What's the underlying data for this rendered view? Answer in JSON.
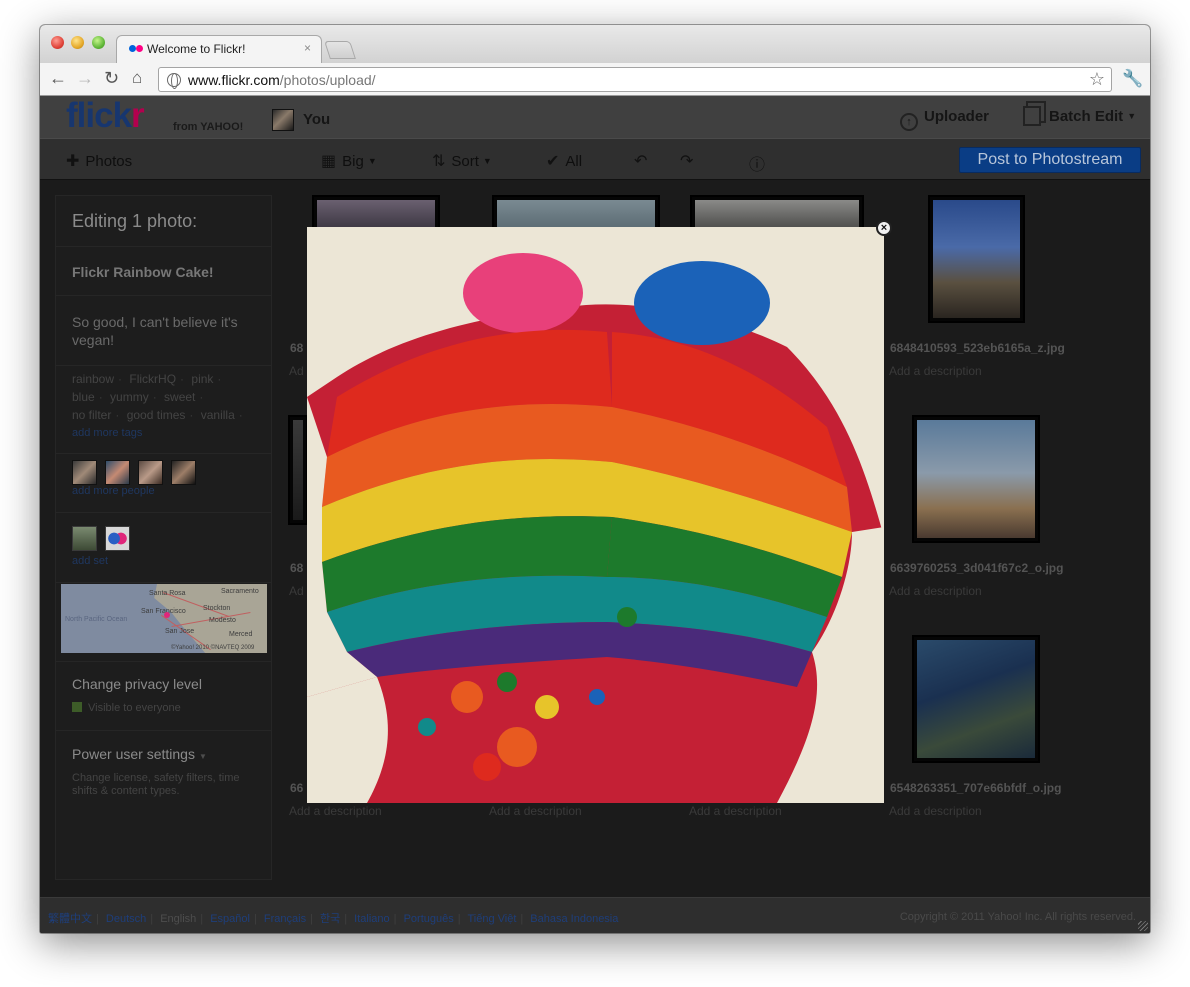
{
  "browser": {
    "tab_title": "Welcome to Flickr!",
    "tab_close": "×",
    "url_host": "www.flickr.com",
    "url_path": "/photos/upload/"
  },
  "header": {
    "logo_main": "flick",
    "logo_accent": "r",
    "logo_from": "from YAHOO!",
    "user_label": "You",
    "uploader_label": "Uploader",
    "batch_label": "Batch Edit"
  },
  "toolbar": {
    "add_photos": "Photos",
    "size_label": "Big",
    "sort_label": "Sort",
    "select_all": "All",
    "post_button": "Post to Photostream"
  },
  "sidebar": {
    "heading": "Editing 1 photo:",
    "photo_title": "Flickr Rainbow Cake!",
    "description": "So good, I can't believe it's vegan!",
    "tags": [
      "rainbow",
      "FlickrHQ",
      "pink",
      "blue",
      "yummy",
      "sweet",
      "no filter",
      "good times",
      "vanilla"
    ],
    "add_tags": "add more tags",
    "add_people": "add more people",
    "add_set": "add set",
    "map_labels": {
      "santa_rosa": "Santa Rosa",
      "sacramento": "Sacramento",
      "san_francisco": "San Francisco",
      "stockton": "Stockton",
      "modesto": "Modesto",
      "san_jose": "San Jose",
      "merced": "Merced",
      "ocean": "North Pacific Ocean",
      "credit": "©Yahoo! 2010 ©NAVTEQ 2009"
    },
    "privacy_title": "Change privacy level",
    "privacy_value": "Visible to everyone",
    "power_title": "Power user settings",
    "power_sub": "Change license, safety filters, time shifts & content types."
  },
  "photos": {
    "name_1": "6848410593_523eb6165a_z.jpg",
    "name_2": "6639760253_3d041f67c2_o.jpg",
    "name_3": "6548263351_707e66bfdf_o.jpg",
    "partial_1": "68",
    "partial_2": "68",
    "partial_3": "66",
    "add_description": "Add a description"
  },
  "footer": {
    "languages": [
      "繁體中文",
      "Deutsch",
      "English",
      "Español",
      "Français",
      "한국",
      "Italiano",
      "Português",
      "Tiếng Việt",
      "Bahasa Indonesia"
    ],
    "current_language": "English",
    "copyright": "Copyright © 2011 Yahoo! Inc. All rights reserved."
  },
  "colors": {
    "flickr_blue": "#0063dc",
    "flickr_pink": "#ff0084",
    "post_button": "#0a3d85"
  }
}
